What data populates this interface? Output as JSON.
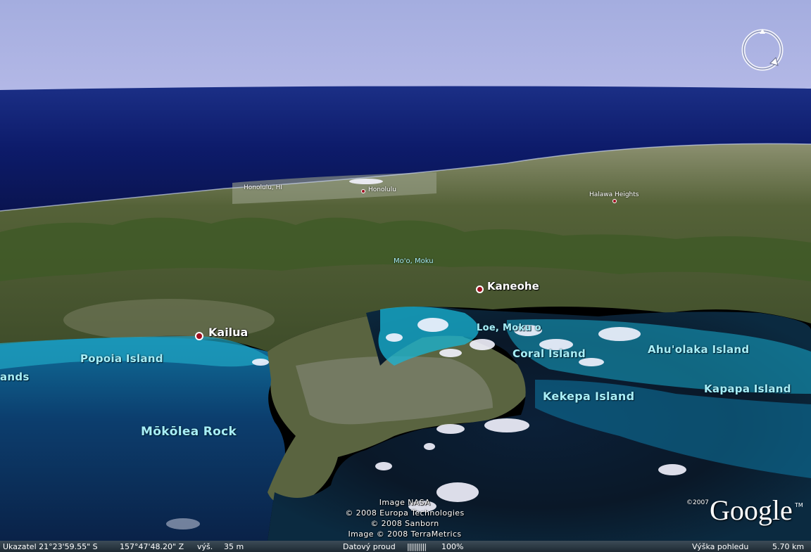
{
  "labels": {
    "honolulu_hi": "Honolulu, HI",
    "honolulu": "Honolulu",
    "halawa_heights": "Halawa Heights",
    "moo_moku": "Mo'o, Moku",
    "kaneohe": "Kaneohe",
    "kailua": "Kailua",
    "loe_moku_o": "Loe, Moku o",
    "coral_island": "Coral Island",
    "ahuolaka_island": "Ahu'olaka Island",
    "popoia_island": "Popoia Island",
    "lands_partial": "ands",
    "kekepa_island": "Kekepa Island",
    "kapapa_island": "Kapapa Island",
    "mokolea_rock": "Mōkōlea Rock"
  },
  "credits": [
    "Image NASA",
    "© 2008 Europa Technologies",
    "© 2008 Sanborn",
    "Image © 2008 TerraMetrics"
  ],
  "logo": {
    "copyright_year": "©2007",
    "brand": "Google",
    "tm": "TM"
  },
  "status": {
    "pointer": "Ukazatel 21°23'59.55\" S",
    "longitude": "157°47'48.20\" Z",
    "elevation_label": "výš.",
    "elevation_value": "35 m",
    "stream_label": "Datový proud",
    "stream_bars": "||||||||||",
    "stream_percent": "100%",
    "eye_alt_label": "Výška pohledu",
    "eye_alt_value": "5.70 km"
  },
  "colors": {
    "sky": "#a9b1e0",
    "ocean_far": "#1a2a7a",
    "land": "#5b6a3c",
    "reef": "#1fa6c4",
    "label_island": "#a8eef6",
    "place_dot": "#a01020"
  },
  "icons": [
    "compass-ring-icon",
    "place-marker-icon"
  ]
}
